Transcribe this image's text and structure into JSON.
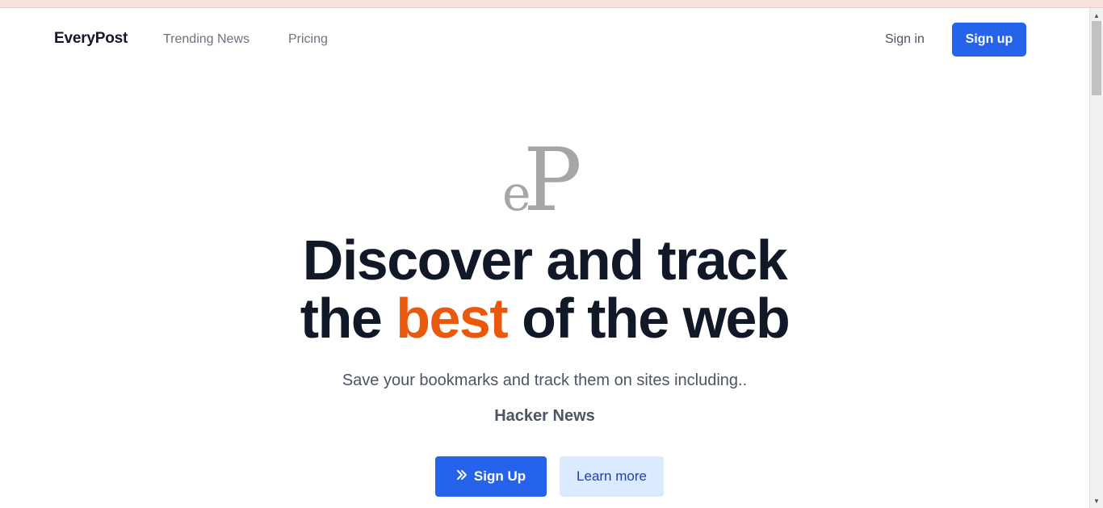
{
  "nav": {
    "brand": "EveryPost",
    "links": [
      {
        "label": "Trending News"
      },
      {
        "label": "Pricing"
      }
    ],
    "sign_in": "Sign in",
    "sign_up": "Sign up"
  },
  "hero": {
    "logo_text": "eP",
    "headline_line1": "Discover and track",
    "headline_line2_prefix": "the ",
    "headline_accent": "best",
    "headline_line2_suffix": " of the web",
    "subtitle": "Save your bookmarks and track them on sites including..",
    "site_name": "Hacker News",
    "cta_primary": "Sign Up",
    "cta_secondary": "Learn more"
  },
  "icons": {
    "cta_primary_icon": "chevrons-right-icon",
    "scroll_up": "triangle-up-icon",
    "scroll_down": "triangle-down-icon"
  },
  "colors": {
    "accent": "#ea580c",
    "primary": "#2563eb",
    "primary_light": "#dbeafe",
    "heading": "#111827",
    "muted": "#6b7280"
  }
}
